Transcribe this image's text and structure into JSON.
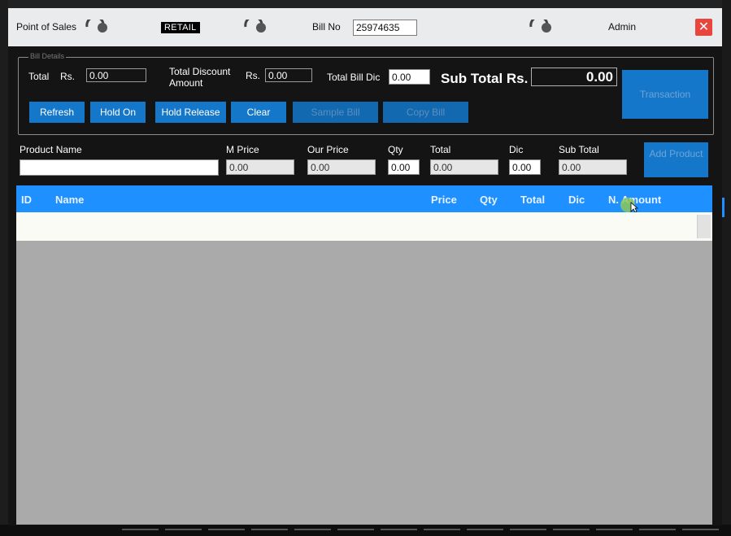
{
  "titlebar": {
    "app_title": "Point of Sales",
    "mode_badge": "RETAIL",
    "bill_no_label": "Bill No",
    "bill_no_value": "25974635",
    "user": "Admin",
    "close_label": "✕"
  },
  "bill_panel": {
    "total_label": "Total",
    "rs_label": "Rs.",
    "total_value": "0.00",
    "total_discount_label": "Total Discount Amount",
    "discount_rs_label": "Rs.",
    "total_discount_value": "0.00",
    "total_bill_dic_label": "Total Bill Dic",
    "total_bill_dic_value": "0.00",
    "sub_total_label": "Sub Total Rs.",
    "sub_total_value": "0.00",
    "buttons": {
      "refresh": "Refresh",
      "hold_on": "Hold On",
      "hold_release": "Hold Release",
      "clear": "Clear",
      "sample_bill": "Sample Bill",
      "copy_bill": "Copy Bill",
      "transaction": "Transaction"
    }
  },
  "product_entry": {
    "product_name_label": "Product Name",
    "product_name_value": "",
    "m_price_label": "M Price",
    "m_price_value": "0.00",
    "our_price_label": "Our Price",
    "our_price_value": "0.00",
    "qty_label": "Qty",
    "qty_value": "0.00",
    "total_label": "Total",
    "total_value": "0.00",
    "dic_label": "Dic",
    "dic_value": "0.00",
    "sub_total_label": "Sub Total",
    "sub_total_value": "0.00",
    "add_product_button": "Add Product"
  },
  "grid": {
    "columns": [
      "ID",
      "Name",
      "Price",
      "Qty",
      "Total",
      "Dic",
      "N. Amount"
    ]
  },
  "colors": {
    "accent": "#1e90ff",
    "button": "#1577c9",
    "close": "#e8453c",
    "panel_bg": "#141414"
  }
}
